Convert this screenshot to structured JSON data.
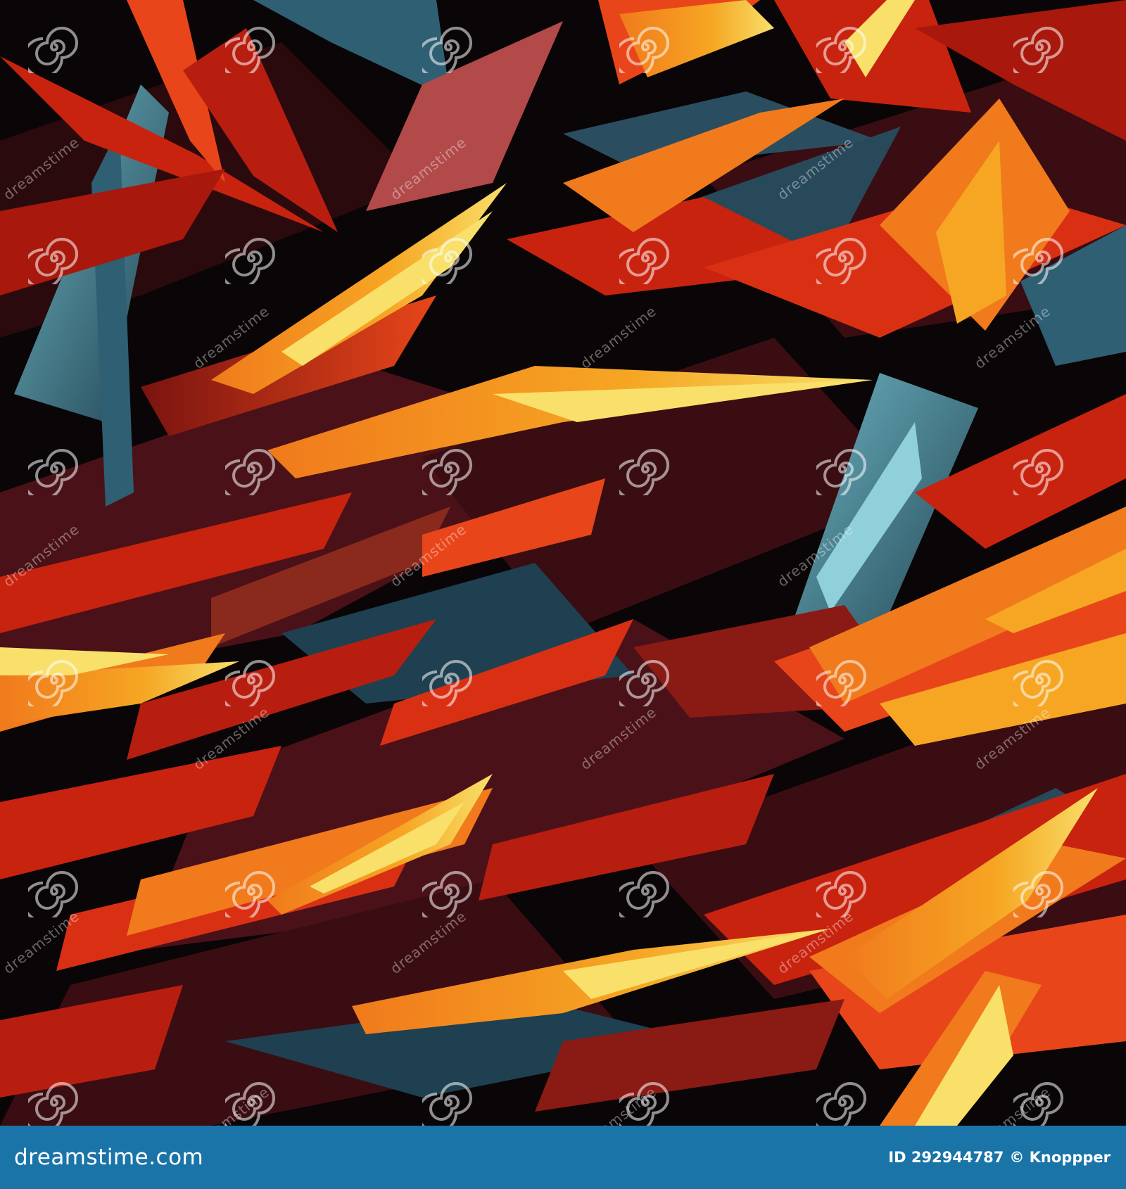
{
  "artwork": {
    "palette": {
      "background": "#0a0506",
      "deep_red": "#7a1410",
      "red": "#c8230f",
      "orange_red": "#e8461a",
      "orange": "#f07a1c",
      "amber": "#f6a623",
      "yellow": "#f8e06a",
      "teal": "#2f5f73",
      "teal_light": "#6fb8c6",
      "maroon": "#4a1218"
    }
  },
  "watermark": {
    "text": "dreamstime",
    "icon": "spiral-logo-icon"
  },
  "footer": {
    "brand": "dreamstime.com",
    "id_label": "ID 292944787",
    "author": "© Knoppper",
    "background": "#1a74a8"
  }
}
